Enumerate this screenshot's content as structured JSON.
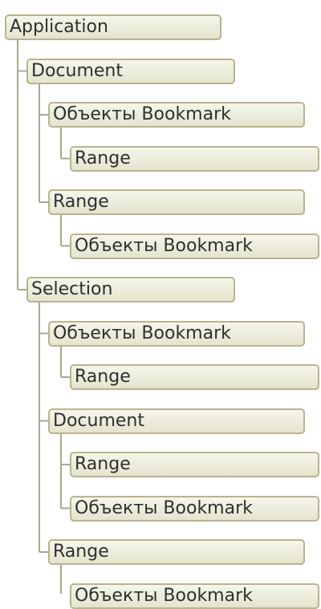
{
  "tree": {
    "label": "Application",
    "children": [
      {
        "label": "Document",
        "children": [
          {
            "label": "Объекты Bookmark",
            "children": [
              {
                "label": "Range",
                "children": []
              }
            ]
          },
          {
            "label": "Range",
            "children": [
              {
                "label": "Объекты Bookmark",
                "children": []
              }
            ]
          }
        ]
      },
      {
        "label": "Selection",
        "children": [
          {
            "label": "Объекты Bookmark",
            "children": [
              {
                "label": "Range",
                "children": []
              }
            ]
          },
          {
            "label": "Document",
            "children": [
              {
                "label": "Range",
                "children": []
              },
              {
                "label": "Объекты Bookmark",
                "children": []
              }
            ]
          },
          {
            "label": "Range",
            "children": [
              {
                "label": "Объекты Bookmark",
                "children": []
              }
            ]
          }
        ]
      }
    ]
  },
  "colors": {
    "node_border": "#b8b48f",
    "node_fill_top": "#f6f6ea",
    "node_fill_bottom": "#e4e4cf",
    "connector": "#a9a98f",
    "text": "#2f2f2f"
  }
}
